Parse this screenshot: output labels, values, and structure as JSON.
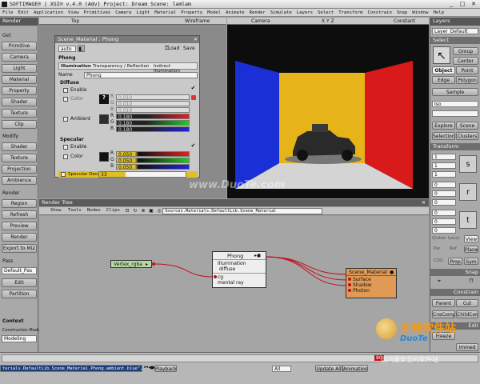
{
  "title_bar": {
    "title": "SOFTIMAGE® | XSI® v.4.0 (Adv) Project: Dream    Scene: lamlam"
  },
  "menu": [
    "File",
    "Edit",
    "Application",
    "View",
    "Primitives",
    "Camera",
    "Light",
    "Material",
    "Property",
    "Model",
    "Animate",
    "Render",
    "Simulate",
    "Layers",
    "Select",
    "Transform",
    "Constrain",
    "Snap",
    "Window",
    "Help"
  ],
  "left_panel": {
    "header": "Render",
    "get_section": "Get",
    "get_items": [
      "Primitive",
      "Camera",
      "Light",
      "Material",
      "Property",
      "Shader",
      "Texture",
      "Clip"
    ],
    "modify_section": "Modify",
    "modify_items": [
      "Shader",
      "Texture",
      "Projection",
      "Ambience"
    ],
    "render_section": "Render",
    "render_items": [
      "Region",
      "Refresh",
      "Preview",
      "Render",
      "Export to MI2"
    ],
    "pass_section": "Pass",
    "pass_value": "Default_Pas",
    "pass_items": [
      "Edit",
      "Partition"
    ],
    "context_label": "Context",
    "construction_mode_label": "Construction Mode",
    "construction_mode_value": "Modeling"
  },
  "viewport_top": {
    "label": "Top",
    "mode": "Wireframe"
  },
  "viewport_camera": {
    "label": "Camera",
    "mode": "Constant",
    "xyz": "X Y Z"
  },
  "property_editor": {
    "title": "Scene_Material : Phong",
    "preset": "auto",
    "load": "Load",
    "save": "Save",
    "section": "Phong",
    "tabs": [
      "Illumination",
      "Transparency / Reflection",
      "Indirect Illumination"
    ],
    "name_label": "Name",
    "name_value": "Phong",
    "diffuse_section": "Diffuse",
    "enable_label": "Enable",
    "color_label": "Color",
    "diffuse_rgb": [
      "0.010",
      "0.010",
      "0.010"
    ],
    "ambient_label": "Ambient",
    "ambient_rgb": [
      "0.180",
      "0.180",
      "0.180"
    ],
    "specular_section": "Specular",
    "spec_enable_label": "Enable",
    "spec_color_label": "Color",
    "specular_rgb": [
      "0.050",
      "0.050",
      "0.050"
    ],
    "rgb_labels": [
      "R",
      "G",
      "B"
    ],
    "specular_decay_label": "Specular Decay",
    "specular_decay_value": "33"
  },
  "render_tree": {
    "title": "Render Tree",
    "menus": [
      "Show",
      "Tools",
      "Nodes",
      "Clips"
    ],
    "path": "Sources.Materials.DefaultLib.Scene_Material",
    "nodes": {
      "vertex": {
        "label": "Vertex_rgba"
      },
      "phong": {
        "label": "Phong",
        "ports": [
          "Illumination",
          "diffuse"
        ],
        "footer": [
          "cg",
          "mental ray"
        ]
      },
      "scene_material": {
        "label": "Scene_Material",
        "ports": [
          "Surface",
          "Shadow",
          "Photon"
        ]
      }
    }
  },
  "right_panel": {
    "header": "Layers",
    "layer_value": "Layer_Default",
    "select_section": "Select",
    "group": "Group",
    "center": "Center",
    "object": "Object",
    "point": "Point",
    "edge": "Edge",
    "polygon": "Polygon",
    "sample": "Sample",
    "filter_value": "Iso",
    "explore": "Explore",
    "scene": "Scene",
    "selection": "Selection",
    "clusters": "Clusters",
    "transform_section": "Transform",
    "transform_values": [
      "1",
      "1",
      "1",
      "0",
      "0",
      "0",
      "0",
      "0",
      "0"
    ],
    "global": "Global",
    "local": "Local",
    "view": "View",
    "par": "Par",
    "ref": "Ref",
    "plane": "Plane",
    "cog": "COG",
    "prop": "Prop",
    "sym": "Sym",
    "snap_section": "Snap",
    "constrain_section": "Constrain",
    "parent": "Parent",
    "cut": "Cut",
    "cns_comp": "CnsComp",
    "child_comp": "ChildComp",
    "edit_section": "Edit",
    "freeze": "Freeze",
    "immed": "Immed"
  },
  "timeline": {
    "command_line": "terials.DefaultLib.Scene_Material.Phong.ambient.blue\",0.18",
    "playback": "Playback",
    "all": "All",
    "update_all": "Update All",
    "animation": "Animation",
    "frame_marker": "80"
  },
  "watermark": {
    "site": "www.DuoTe.com",
    "brand_cn": "多特软件站",
    "brand_en": "DuoTe",
    "slogan": "国内最安全的软件站"
  },
  "colors": {
    "accent_yellow": "#e0c020",
    "node_orange": "#e09a55",
    "node_green": "#b9d9a4",
    "wire_red": "#c0101a"
  }
}
